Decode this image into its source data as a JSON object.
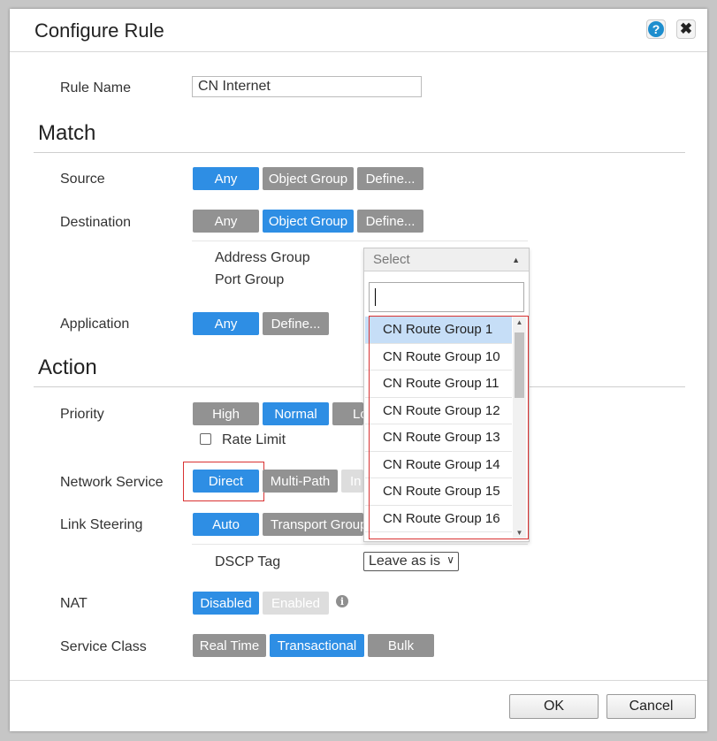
{
  "dialog": {
    "title": "Configure Rule",
    "help_glyph": "?",
    "close_glyph": "✖"
  },
  "rule_name": {
    "label": "Rule Name",
    "value": "CN Internet"
  },
  "match": {
    "heading": "Match",
    "source": {
      "label": "Source",
      "buttons": [
        "Any",
        "Object Group",
        "Define..."
      ],
      "active": "Any"
    },
    "destination": {
      "label": "Destination",
      "buttons": [
        "Any",
        "Object Group",
        "Define..."
      ],
      "active": "Object Group",
      "address_group_label": "Address Group",
      "port_group_label": "Port Group"
    },
    "application": {
      "label": "Application",
      "buttons": [
        "Any",
        "Define..."
      ],
      "active": "Any"
    }
  },
  "action": {
    "heading": "Action",
    "priority": {
      "label": "Priority",
      "buttons": [
        "High",
        "Normal",
        "Lo"
      ],
      "active": "Normal"
    },
    "rate_limit": {
      "label": "Rate Limit",
      "checked": false
    },
    "network_service": {
      "label": "Network Service",
      "buttons": [
        "Direct",
        "Multi-Path",
        "In"
      ],
      "active": "Direct"
    },
    "link_steering": {
      "label": "Link Steering",
      "buttons": [
        "Auto",
        "Transport Group"
      ],
      "active": "Auto"
    },
    "dscp_tag": {
      "label": "DSCP Tag",
      "value": "Leave as is"
    },
    "nat": {
      "label": "NAT",
      "buttons": [
        "Disabled",
        "Enabled"
      ],
      "active": "Disabled",
      "info_glyph": "i"
    },
    "service_class": {
      "label": "Service Class",
      "buttons": [
        "Real Time",
        "Transactional",
        "Bulk"
      ],
      "active": "Transactional"
    }
  },
  "dropdown": {
    "placeholder": "Select",
    "search_value": "",
    "items": [
      "CN Route Group 1",
      "CN Route Group 10",
      "CN Route Group 11",
      "CN Route Group 12",
      "CN Route Group 13",
      "CN Route Group 14",
      "CN Route Group 15",
      "CN Route Group 16"
    ],
    "selected": "CN Route Group 1"
  },
  "footer": {
    "ok": "OK",
    "cancel": "Cancel"
  },
  "colors": {
    "active_button": "#2e8ee4",
    "inactive_button": "#929292",
    "highlight_border": "#d93232",
    "selected_row": "#c6def7"
  }
}
